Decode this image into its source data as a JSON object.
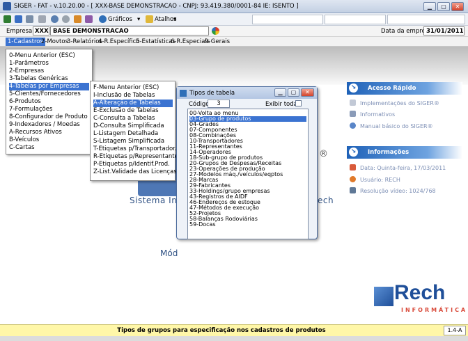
{
  "window": {
    "title": "SIGER - FAT - v.10.20.00 - [ XXX-BASE DEMONSTRACAO - CNPJ: 93.419.380/0001-84 IE: ISENTO ]",
    "minimize": "▁",
    "maximize": "▢",
    "close": "✕"
  },
  "toolbar": {
    "graficos_label": "Gráficos",
    "atalhos_label": "Atalhos"
  },
  "empresa": {
    "label": "Empresa",
    "code": "XXX",
    "name": "BASE DEMONSTRACAO",
    "date_label": "Data da empresa",
    "date_value": "31/01/2011"
  },
  "menubar": {
    "items": [
      "1-Cadastros",
      "2-Movtos",
      "3-Relatórios",
      "4-R.Específico",
      "5-Estatísticas",
      "6-R.Especiais",
      "9-Gerais"
    ]
  },
  "menu_cadastros": {
    "items": [
      "0-Menu Anterior (ESC)",
      "1-Parâmetros",
      "2-Empresas",
      "3-Tabelas Genéricas",
      "4-Tabelas por Empresas",
      "5-Clientes/Fornecedores",
      "6-Produtos",
      "7-Formulações",
      "8-Configurador de Produto",
      "9-Indexadores / Moedas",
      "A-Recursos Ativos",
      "B-Veículos",
      "C-Cartas"
    ],
    "selected_index": 4
  },
  "menu_tabelas": {
    "items": [
      "F-Menu Anterior (ESC)",
      "I-Inclusão de Tabelas",
      "A-Alteração de Tabelas",
      "E-Exclusão de Tabelas",
      "C-Consulta a Tabelas",
      "D-Consulta Simplificada",
      "L-Listagem Detalhada",
      "S-Listagem Simplificada",
      "T-Etiquetas p/Transportador.",
      "R-Etiquetas p/Representantes",
      "P-Etiquetas p/Identif.Prod.",
      "Z-List.Validade das Licenças"
    ],
    "selected_index": 2
  },
  "dialog": {
    "title": "Tipos de tabela",
    "codigo_label": "Código",
    "codigo_value": "3",
    "exibir_label": "Exibir todas",
    "items": [
      "00-Volta ao menu",
      "03-Grupo de produtos",
      "04-Grades",
      "07-Componentes",
      "08-Combinações",
      "10-Transportadores",
      "11-Representantes",
      "14-Operadores",
      "18-Sub-grupo de produtos",
      "20-Grupos de Despesas/Receitas",
      "23-Operações de produção",
      "27-Modelos máq./veículos/eqptos",
      "28-Marcas",
      "29-Fabricantes",
      "33-Holdings/grupo empresas",
      "43-Registros de AIDF",
      "46-Endereços de estoque",
      "47-Métodos de execução",
      "52-Projetos",
      "58-Balanças Rodoviárias",
      "59-Docas"
    ],
    "selected_index": 1
  },
  "background": {
    "sistema_text": "Sistema In",
    "sistema_tail": "ech",
    "modulo_text": "Mód",
    "reg_mark": "®"
  },
  "right_panel": {
    "acesso_title": "Acesso Rápido",
    "acesso_items": [
      "Implementações do SIGER®",
      "Informativos",
      "Manual básico do SIGER®"
    ],
    "info_title": "Informações",
    "info_items": [
      "Data: Quinta-feira, 17/03/2011",
      "Usuário: RECH",
      "Resolução vídeo: 1024/768"
    ]
  },
  "logo": {
    "name": "Rech",
    "sub": "INFORMÁTICA"
  },
  "statusbar": {
    "message": "Tipos de grupos para especificação nos cadastros de produtos",
    "version": "1.4-A"
  },
  "colors": {
    "accent": "#3b73d1",
    "header_blue": "#1f62b8",
    "status_yellow": "#fff7a8",
    "icon_red": "#d93b2b"
  }
}
